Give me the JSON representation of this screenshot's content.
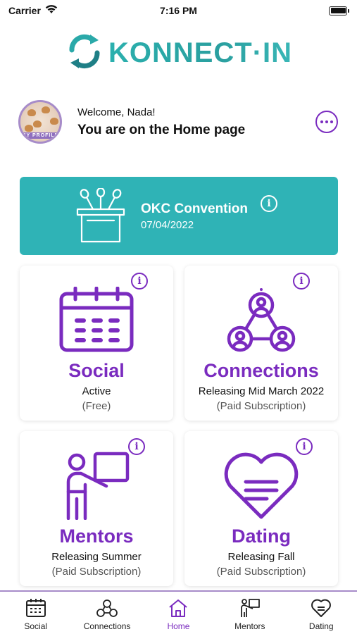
{
  "status_bar": {
    "carrier": "Carrier",
    "time": "7:16 PM"
  },
  "brand": {
    "logo_text": "KONNECT·IN",
    "color_teal": "#2fb3b6",
    "color_purple": "#7a2bbf"
  },
  "welcome": {
    "greeting": "Welcome, Nada!",
    "page_message": "You are on the Home page",
    "avatar_badge": "MY PROFILE"
  },
  "event": {
    "title": "OKC Convention",
    "date": "07/04/2022",
    "info_label": "i"
  },
  "cards": [
    {
      "title": "Social",
      "status": "Active",
      "price": "(Free)",
      "icon": "calendar-icon",
      "info_label": "i"
    },
    {
      "title": "Connections",
      "status": "Releasing Mid March 2022",
      "price": "(Paid Subscription)",
      "icon": "network-icon",
      "info_label": "i"
    },
    {
      "title": "Mentors",
      "status": "Releasing Summer",
      "price": "(Paid Subscription)",
      "icon": "teacher-icon",
      "info_label": "i"
    },
    {
      "title": "Dating",
      "status": "Releasing Fall",
      "price": "(Paid Subscription)",
      "icon": "heart-icon",
      "info_label": "i"
    }
  ],
  "tabs": [
    {
      "label": "Social",
      "icon": "calendar-icon",
      "active": false
    },
    {
      "label": "Connections",
      "icon": "network-icon",
      "active": false
    },
    {
      "label": "Home",
      "icon": "home-icon",
      "active": true
    },
    {
      "label": "Mentors",
      "icon": "teacher-icon",
      "active": false
    },
    {
      "label": "Dating",
      "icon": "heart-icon",
      "active": false
    }
  ]
}
